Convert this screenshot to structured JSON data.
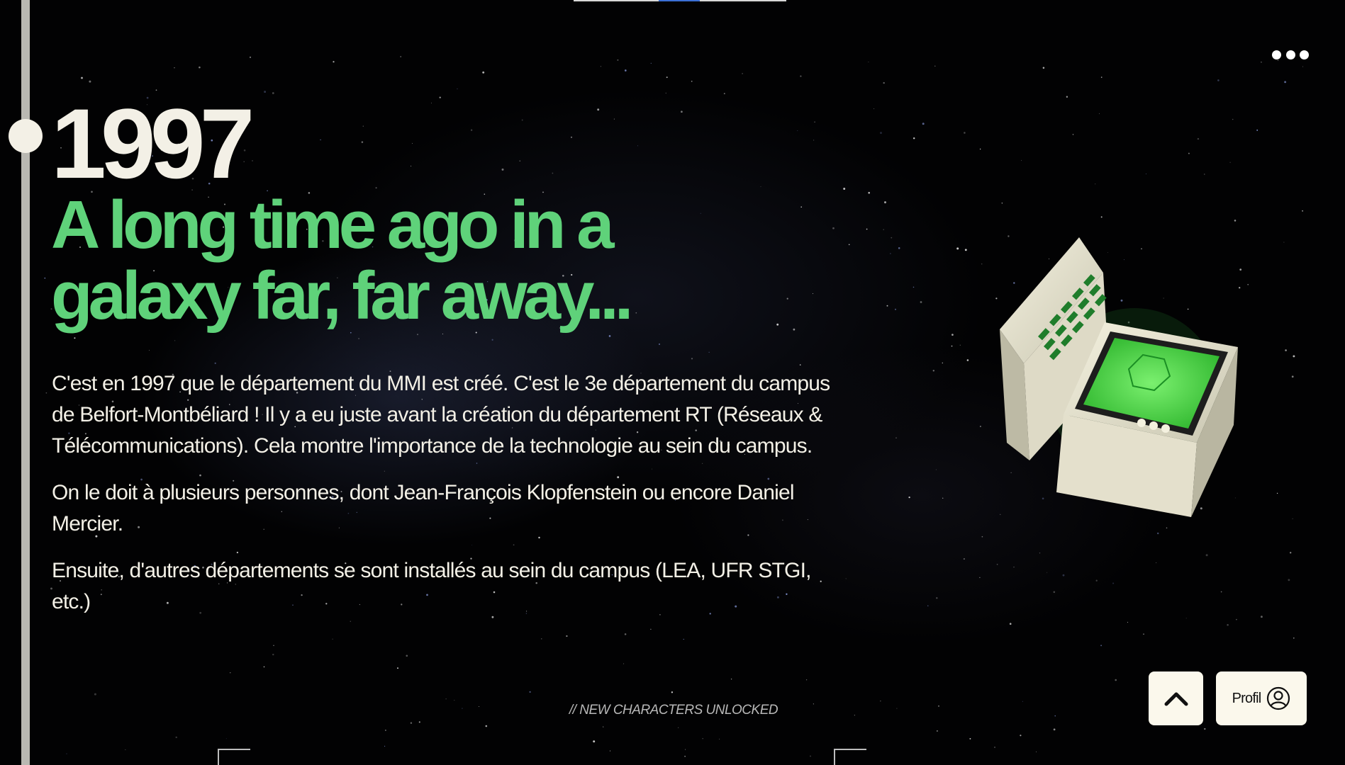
{
  "hero": {
    "year": "1997",
    "headline": "A long time ago in a galaxy far, far away...",
    "paragraphs": [
      "C'est en 1997 que le département du MMI est créé. C'est le 3e département du campus de Belfort-Montbéliard ! Il y a eu juste avant la création du département RT (Réseaux & Télécommunications). Cela montre l'importance de la technologie au sein du campus.",
      "On le doit à plusieurs personnes, dont Jean-François Klopfenstein ou encore Daniel Mercier.",
      "Ensuite, d'autres départements se sont installés au sein du campus (LEA, UFR STGI, etc.)"
    ]
  },
  "section": {
    "caption": "// NEW CHARACTERS UNLOCKED"
  },
  "buttons": {
    "profile_label": "Profil",
    "scroll_top_icon": "chevron-up-icon",
    "profile_icon": "user-circle-icon",
    "menu_icon": "more-horizontal-icon"
  },
  "colors": {
    "accent": "#5fd27a",
    "text": "#f3f0e6",
    "background": "#020203",
    "button_bg": "#fbf8ec"
  }
}
